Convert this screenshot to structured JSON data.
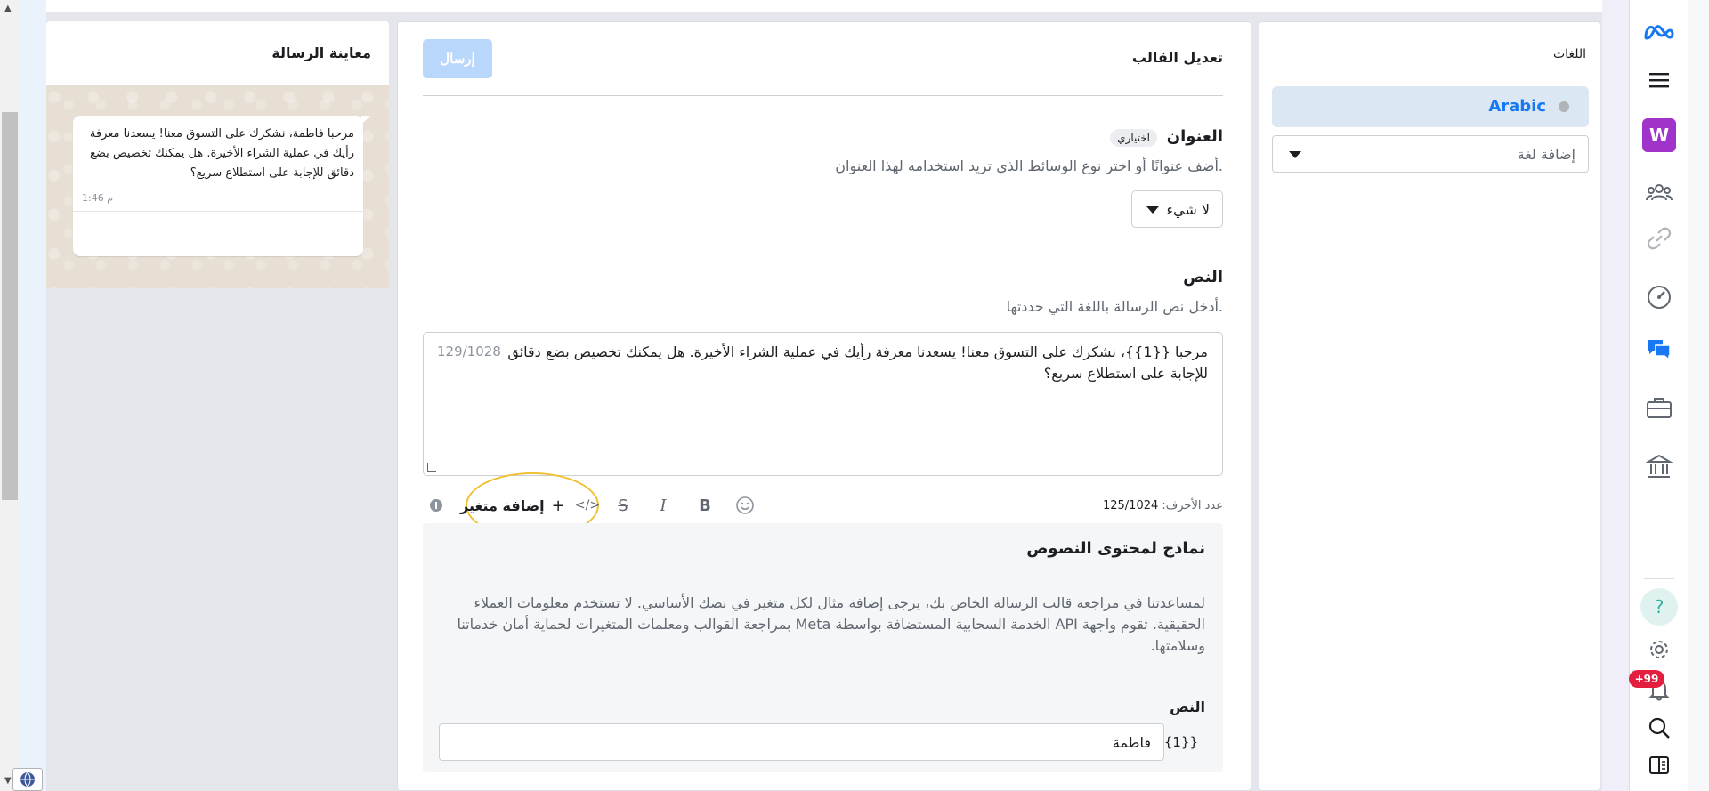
{
  "languages": {
    "title": "اللغات",
    "items": [
      {
        "label": "Arabic"
      }
    ],
    "add_placeholder": "إضافة لغة"
  },
  "editor": {
    "title": "تعديل القالب",
    "send_label": "إرسال",
    "header": {
      "title": "العنوان",
      "optional": "اختياري",
      "description": "أضف عنوانًا أو اختر نوع الوسائط الذي تريد استخدامه لهذا العنوان.",
      "select_value": "لا شيء"
    },
    "body": {
      "title": "النص",
      "description": "أدخل نص الرسالة باللغة التي حددتها.",
      "text": "مرحبا {{1}}، نشكرك على التسوق معنا! يسعدنا معرفة رأيك في عملية الشراء الأخيرة. هل يمكنك تخصيص بضع دقائق للإجابة على استطلاع سريع؟",
      "count": "129/1028",
      "char_count_label": "عدد الأحرف:",
      "char_count_value": "125/1024",
      "add_variable_label": "إضافة متغير"
    },
    "samples": {
      "title": "نماذج لمحتوى النصوص",
      "description": "لمساعدتنا في مراجعة قالب الرسالة الخاص بك، يرجى إضافة مثال لكل متغير في نصك الأساسي. لا تستخدم معلومات العملاء الحقيقية. تقوم واجهة API الخدمة السحابية المستضافة بواسطة Meta بمراجعة القوالب ومعلمات المتغيرات لحماية أمان خدماتنا وسلامتها.",
      "body_label": "النص",
      "variable_tag": "{{1}}",
      "variable_value": "فاطمة"
    }
  },
  "preview": {
    "title": "معاينة الرسالة",
    "message": "مرحبا فاطمة، نشكرك على التسوق معنا! يسعدنا معرفة رأيك في عملية الشراء الأخيرة. هل يمكنك تخصيص بضع دقائق للإجابة على استطلاع سريع؟",
    "time": "1:46 م"
  },
  "rail": {
    "workspace_letter": "W",
    "notifications_badge": "+99",
    "help_label": "?"
  },
  "colors": {
    "accent": "#1877f2",
    "workspace": "#a033c9",
    "badge": "#e41e3f",
    "highlight": "#f0c030"
  }
}
